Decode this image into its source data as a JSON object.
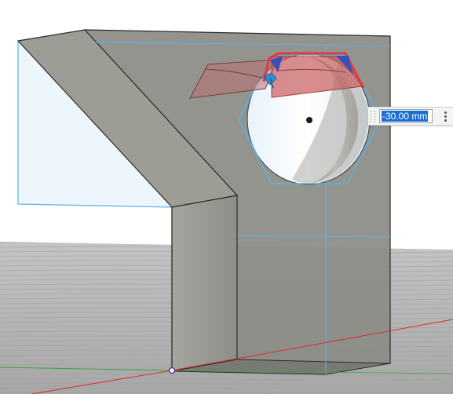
{
  "viewport": {
    "colors": {
      "background": "#ffffff",
      "ground": "#b3b3b3",
      "part_face": "#8b8b86",
      "side_face": "#9b9b94",
      "sketch_blue": "#5ab3df",
      "highlight_red": "#e8353a",
      "x_axis": "#e2262b",
      "y_axis": "#3aa53a"
    },
    "features": [
      "hexagon-sketch",
      "circular-hole",
      "extrude-preview",
      "origin-point"
    ]
  },
  "dimension_input": {
    "value": "-30.00 mm",
    "menu_icon": "vertical-ellipsis-icon"
  }
}
